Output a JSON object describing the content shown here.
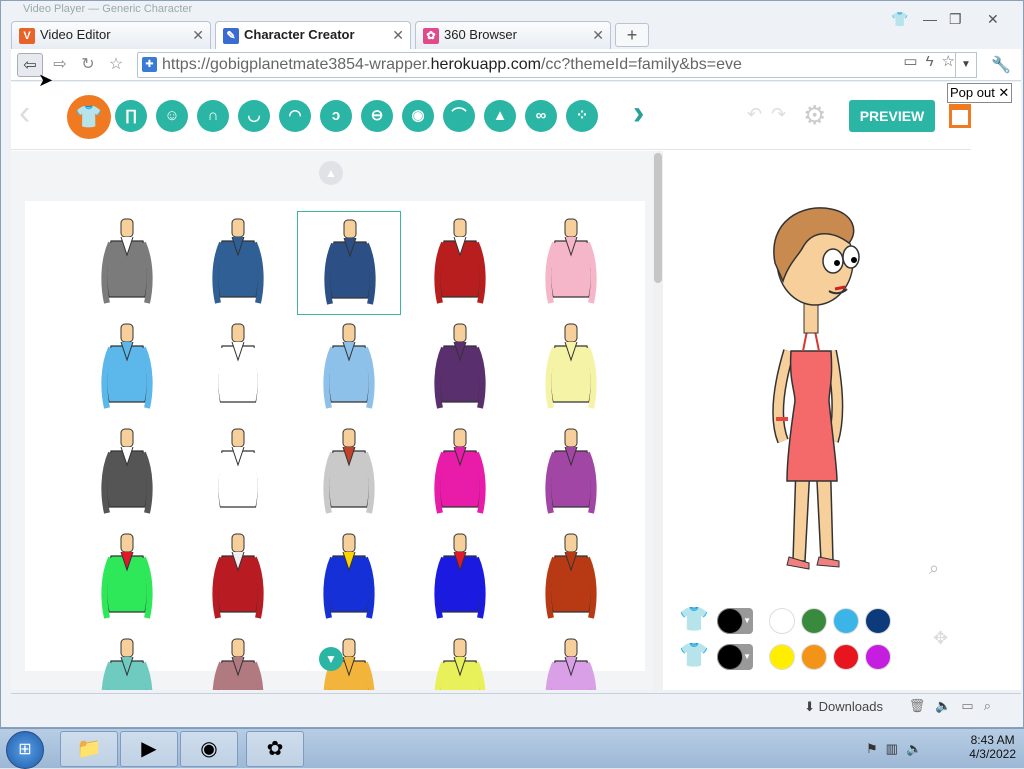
{
  "window": {
    "title_strip": "Video Player — Generic Character"
  },
  "tabs": [
    {
      "label": "Video Editor",
      "favicon": "V",
      "favicon_color": "#e8632a"
    },
    {
      "label": "Character Creator",
      "favicon": "✎",
      "favicon_color": "#3a6bd0"
    },
    {
      "label": "360 Browser",
      "favicon": "✿",
      "favicon_color": "#e04a8a"
    }
  ],
  "newtab_label": "+",
  "toolbar": {
    "url_scheme": "https://",
    "url_host_pre": "gobigplanetmate3854-wrapper.",
    "url_host": "herokuapp.com",
    "url_path": "/cc?themeId=family&bs=eve"
  },
  "popout_label": "Pop out ✕",
  "app": {
    "preview_label": "PREVIEW",
    "categories": [
      "shirt-icon",
      "pants-icon",
      "face-icon",
      "hair-icon",
      "jaw-icon",
      "mouth-icon",
      "ear-icon",
      "nose-bridge-icon",
      "eye-icon",
      "eyebrow-icon",
      "nose-icon",
      "glasses-icon",
      "facial-hair-icon"
    ],
    "selected_item_index": 2,
    "accent": "#2bb5a5",
    "category_active": "#f07a22"
  },
  "clothes": [
    {
      "name": "grey blazer",
      "color": "#7b7b7b",
      "inner": "#ffffff"
    },
    {
      "name": "blue tank",
      "color": "#2f5f94",
      "inner": "#2f5f94"
    },
    {
      "name": "blue halter",
      "color": "#2c4f86",
      "inner": "#2c4f86"
    },
    {
      "name": "red tube",
      "color": "#b91e1e",
      "inner": "#ffffff"
    },
    {
      "name": "pink tee badge",
      "color": "#f4b6c8",
      "inner": "#f4b6c8"
    },
    {
      "name": "sky tee",
      "color": "#5cb8ea",
      "inner": "#5cb8ea"
    },
    {
      "name": "white shirt badge",
      "color": "#ffffff",
      "inner": "#ffffff"
    },
    {
      "name": "light blue shirt",
      "color": "#8ec1ea",
      "inner": "#8ec1ea"
    },
    {
      "name": "purple jacket",
      "color": "#5a2f6e",
      "inner": "#5a2f6e"
    },
    {
      "name": "pale yellow jacket",
      "color": "#f5f3a6",
      "inner": "#f5f3a6"
    },
    {
      "name": "grey vest tie",
      "color": "#555555",
      "inner": "#ffffff"
    },
    {
      "name": "white shirt tie",
      "color": "#ffffff",
      "inner": "#ffffff"
    },
    {
      "name": "grey vneck",
      "color": "#c9c9c9",
      "inner": "#c2412a"
    },
    {
      "name": "magenta shirt",
      "color": "#e81ca8",
      "inner": "#e81ca8"
    },
    {
      "name": "purple halter",
      "color": "#a246a6",
      "inner": "#a246a6"
    },
    {
      "name": "green red sleeve",
      "color": "#2ee85a",
      "inner": "#e0182a"
    },
    {
      "name": "red crop jacket",
      "color": "#b81c22",
      "inner": "#f0f0f0"
    },
    {
      "name": "blue jacket",
      "color": "#1630d8",
      "inner": "#ffd400"
    },
    {
      "name": "blue red tee",
      "color": "#1a1ae0",
      "inner": "#e0182a"
    },
    {
      "name": "orange jacket",
      "color": "#b83a14",
      "inner": "#b83a14"
    },
    {
      "name": "teal tee",
      "color": "#6fcac0",
      "inner": "#6fcac0"
    },
    {
      "name": "mauve hoodie",
      "color": "#b07a80",
      "inner": "#b07a80"
    },
    {
      "name": "gold tee",
      "color": "#f2b43a",
      "inner": "#f2b43a"
    },
    {
      "name": "yellow tee",
      "color": "#e8f05a",
      "inner": "#e8f05a"
    },
    {
      "name": "lavender tee",
      "color": "#d9a0e8",
      "inner": "#d9a0e8"
    }
  ],
  "colors_row1": [
    "#000000",
    "#ffffff",
    "#3a8a3e",
    "#3bb4e8",
    "#0d3a7a"
  ],
  "colors_row2": [
    "#000000",
    "#ffee00",
    "#f39418",
    "#e8141e",
    "#c61ee0"
  ],
  "status": {
    "downloads": "Downloads"
  },
  "taskbar": {
    "time": "8:43 AM",
    "date": "4/3/2022"
  }
}
